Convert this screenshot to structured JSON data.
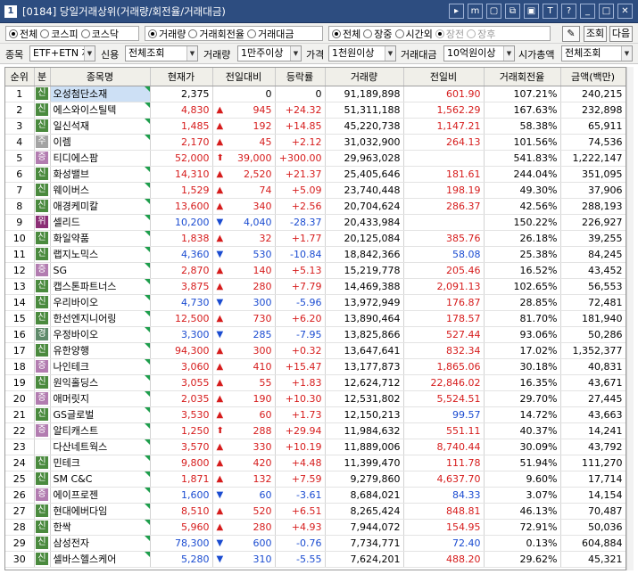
{
  "title": {
    "num": "1",
    "text": "[0184] 당일거래상위(거래량/회전율/거래대금)"
  },
  "titlebar_icons": [
    "▸",
    "m",
    "▢",
    "⧉",
    "▣",
    "T",
    "?",
    "_",
    "□",
    "✕"
  ],
  "icon_names": [
    "menu-arrow-icon",
    "memo-icon",
    "link-icon",
    "copy-icon",
    "window-icon",
    "font-icon",
    "help-icon",
    "minimize-icon",
    "maximize-icon",
    "close-icon"
  ],
  "market_group": [
    {
      "label": "전체",
      "checked": true
    },
    {
      "label": "코스피",
      "checked": false
    },
    {
      "label": "코스닥",
      "checked": false
    }
  ],
  "sort_group": [
    {
      "label": "거래량",
      "checked": true
    },
    {
      "label": "거래회전율",
      "checked": false
    },
    {
      "label": "거래대금",
      "checked": false
    }
  ],
  "session_group": [
    {
      "label": "전체",
      "checked": true,
      "disabled": false
    },
    {
      "label": "장중",
      "checked": false,
      "disabled": false
    },
    {
      "label": "시간외",
      "checked": false,
      "disabled": false
    },
    {
      "label": "장전",
      "checked": true,
      "disabled": true
    },
    {
      "label": "장후",
      "checked": false,
      "disabled": true
    }
  ],
  "buttons": {
    "query": "조회",
    "next": "다음"
  },
  "filters": {
    "item_label": "종목",
    "item_value": "ETF+ETN 제",
    "credit_label": "신용",
    "credit_value": "전체조회",
    "volume_label": "거래량",
    "volume_value": "1만주이상",
    "price_label": "가격",
    "price_value": "1천원이상",
    "amount_label": "거래대금",
    "amount_value": "10억원이상",
    "cap_label": "시가총액",
    "cap_value": "전체조회"
  },
  "columns": [
    "순위",
    "분",
    "종목명",
    "현재가",
    "전일대비",
    "등락률",
    "거래량",
    "전일비",
    "거래회전율",
    "금액(백만)"
  ],
  "rows": [
    {
      "rank": "1",
      "badge": "신",
      "name": "오성첨단소재",
      "price": "2,375",
      "dir": "",
      "change": "0",
      "rate": "0",
      "volume": "91,189,898",
      "prev": "601.90",
      "turnover": "107.21%",
      "amount": "240,215",
      "flag": true
    },
    {
      "rank": "2",
      "badge": "신",
      "name": "에스와이스틸텍",
      "price": "4,830",
      "dir": "up",
      "change": "945",
      "rate": "+24.32",
      "volume": "51,311,188",
      "prev": "1,562.29",
      "turnover": "167.63%",
      "amount": "232,898",
      "flag": true
    },
    {
      "rank": "3",
      "badge": "신",
      "name": "일신석재",
      "price": "1,485",
      "dir": "up",
      "change": "192",
      "rate": "+14.85",
      "volume": "45,220,738",
      "prev": "1,147.21",
      "turnover": "58.38%",
      "amount": "65,911",
      "flag": true
    },
    {
      "rank": "4",
      "badge": "주",
      "name": "이렘",
      "price": "2,170",
      "dir": "up",
      "change": "45",
      "rate": "+2.12",
      "volume": "31,032,900",
      "prev": "264.13",
      "turnover": "101.56%",
      "amount": "74,536",
      "flag": true
    },
    {
      "rank": "5",
      "badge": "증",
      "name": "티디에스팜",
      "price": "52,000",
      "dir": "upper",
      "change": "39,000",
      "rate": "+300.00",
      "volume": "29,963,028",
      "prev": "",
      "turnover": "541.83%",
      "amount": "1,222,147",
      "flag": false
    },
    {
      "rank": "6",
      "badge": "신",
      "name": "화성밸브",
      "price": "14,310",
      "dir": "up",
      "change": "2,520",
      "rate": "+21.37",
      "volume": "25,405,646",
      "prev": "181.61",
      "turnover": "244.04%",
      "amount": "351,095",
      "flag": true
    },
    {
      "rank": "7",
      "badge": "신",
      "name": "웨이버스",
      "price": "1,529",
      "dir": "up",
      "change": "74",
      "rate": "+5.09",
      "volume": "23,740,448",
      "prev": "198.19",
      "turnover": "49.30%",
      "amount": "37,906",
      "flag": true
    },
    {
      "rank": "8",
      "badge": "신",
      "name": "애경케미칼",
      "price": "13,600",
      "dir": "up",
      "change": "340",
      "rate": "+2.56",
      "volume": "20,704,624",
      "prev": "286.37",
      "turnover": "42.56%",
      "amount": "288,193",
      "flag": true
    },
    {
      "rank": "9",
      "badge": "위",
      "name": "셀리드",
      "price": "10,200",
      "dir": "dn",
      "change": "4,040",
      "rate": "-28.37",
      "volume": "20,433,984",
      "prev": "",
      "turnover": "150.22%",
      "amount": "226,927",
      "flag": true
    },
    {
      "rank": "10",
      "badge": "신",
      "name": "화일약품",
      "price": "1,838",
      "dir": "up",
      "change": "32",
      "rate": "+1.77",
      "volume": "20,125,084",
      "prev": "385.76",
      "turnover": "26.18%",
      "amount": "39,255",
      "flag": true
    },
    {
      "rank": "11",
      "badge": "신",
      "name": "랩지노믹스",
      "price": "4,360",
      "dir": "dn",
      "change": "530",
      "rate": "-10.84",
      "volume": "18,842,366",
      "prev": "58.08",
      "turnover": "25.38%",
      "amount": "84,245",
      "flag": true
    },
    {
      "rank": "12",
      "badge": "증",
      "name": "SG",
      "price": "2,870",
      "dir": "up",
      "change": "140",
      "rate": "+5.13",
      "volume": "15,219,778",
      "prev": "205.46",
      "turnover": "16.52%",
      "amount": "43,452",
      "flag": true
    },
    {
      "rank": "13",
      "badge": "신",
      "name": "캡스톤파트너스",
      "price": "3,875",
      "dir": "up",
      "change": "280",
      "rate": "+7.79",
      "volume": "14,469,388",
      "prev": "2,091.13",
      "turnover": "102.65%",
      "amount": "56,553",
      "flag": true
    },
    {
      "rank": "14",
      "badge": "신",
      "name": "우리바이오",
      "price": "4,730",
      "dir": "dn",
      "change": "300",
      "rate": "-5.96",
      "volume": "13,972,949",
      "prev": "176.87",
      "turnover": "28.85%",
      "amount": "72,481",
      "flag": true
    },
    {
      "rank": "15",
      "badge": "신",
      "name": "한선엔지니어링",
      "price": "12,500",
      "dir": "up",
      "change": "730",
      "rate": "+6.20",
      "volume": "13,890,464",
      "prev": "178.57",
      "turnover": "81.70%",
      "amount": "181,940",
      "flag": true
    },
    {
      "rank": "16",
      "badge": "경",
      "name": "우정바이오",
      "price": "3,300",
      "dir": "dn",
      "change": "285",
      "rate": "-7.95",
      "volume": "13,825,866",
      "prev": "527.44",
      "turnover": "93.06%",
      "amount": "50,286",
      "flag": true
    },
    {
      "rank": "17",
      "badge": "신",
      "name": "유한양행",
      "price": "94,300",
      "dir": "up",
      "change": "300",
      "rate": "+0.32",
      "volume": "13,647,641",
      "prev": "832.34",
      "turnover": "17.02%",
      "amount": "1,352,377",
      "flag": true
    },
    {
      "rank": "18",
      "badge": "증",
      "name": "나인테크",
      "price": "3,060",
      "dir": "up",
      "change": "410",
      "rate": "+15.47",
      "volume": "13,177,873",
      "prev": "1,865.06",
      "turnover": "30.18%",
      "amount": "40,831",
      "flag": true
    },
    {
      "rank": "19",
      "badge": "신",
      "name": "원익홀딩스",
      "price": "3,055",
      "dir": "up",
      "change": "55",
      "rate": "+1.83",
      "volume": "12,624,712",
      "prev": "22,846.02",
      "turnover": "16.35%",
      "amount": "43,671",
      "flag": true
    },
    {
      "rank": "20",
      "badge": "증",
      "name": "애머릿지",
      "price": "2,035",
      "dir": "up",
      "change": "190",
      "rate": "+10.30",
      "volume": "12,531,802",
      "prev": "5,524.51",
      "turnover": "29.70%",
      "amount": "27,445",
      "flag": true
    },
    {
      "rank": "21",
      "badge": "신",
      "name": "GS글로벌",
      "price": "3,530",
      "dir": "up",
      "change": "60",
      "rate": "+1.73",
      "volume": "12,150,213",
      "prev": "99.57",
      "turnover": "14.72%",
      "amount": "43,663",
      "flag": true
    },
    {
      "rank": "22",
      "badge": "증",
      "name": "알티캐스트",
      "price": "1,250",
      "dir": "upper",
      "change": "288",
      "rate": "+29.94",
      "volume": "11,984,632",
      "prev": "551.11",
      "turnover": "40.37%",
      "amount": "14,241",
      "flag": true
    },
    {
      "rank": "23",
      "badge": "",
      "name": "다산네트웍스",
      "price": "3,570",
      "dir": "up",
      "change": "330",
      "rate": "+10.19",
      "volume": "11,889,006",
      "prev": "8,740.44",
      "turnover": "30.09%",
      "amount": "43,792",
      "flag": true
    },
    {
      "rank": "24",
      "badge": "신",
      "name": "민테크",
      "price": "9,800",
      "dir": "up",
      "change": "420",
      "rate": "+4.48",
      "volume": "11,399,470",
      "prev": "111.78",
      "turnover": "51.94%",
      "amount": "111,270",
      "flag": true
    },
    {
      "rank": "25",
      "badge": "신",
      "name": "SM C&C",
      "price": "1,871",
      "dir": "up",
      "change": "132",
      "rate": "+7.59",
      "volume": "9,279,860",
      "prev": "4,637.70",
      "turnover": "9.60%",
      "amount": "17,714",
      "flag": true
    },
    {
      "rank": "26",
      "badge": "증",
      "name": "에이프로젠",
      "price": "1,600",
      "dir": "dn",
      "change": "60",
      "rate": "-3.61",
      "volume": "8,684,021",
      "prev": "84.33",
      "turnover": "3.07%",
      "amount": "14,154",
      "flag": true
    },
    {
      "rank": "27",
      "badge": "신",
      "name": "현대에버다임",
      "price": "8,510",
      "dir": "up",
      "change": "520",
      "rate": "+6.51",
      "volume": "8,265,424",
      "prev": "848.81",
      "turnover": "46.13%",
      "amount": "70,487",
      "flag": true
    },
    {
      "rank": "28",
      "badge": "신",
      "name": "한싹",
      "price": "5,960",
      "dir": "up",
      "change": "280",
      "rate": "+4.93",
      "volume": "7,944,072",
      "prev": "154.95",
      "turnover": "72.91%",
      "amount": "50,036",
      "flag": true
    },
    {
      "rank": "29",
      "badge": "신",
      "name": "삼성전자",
      "price": "78,300",
      "dir": "dn",
      "change": "600",
      "rate": "-0.76",
      "volume": "7,734,771",
      "prev": "72.40",
      "turnover": "0.13%",
      "amount": "604,884",
      "flag": true
    },
    {
      "rank": "30",
      "badge": "신",
      "name": "셀바스헬스케어",
      "price": "5,280",
      "dir": "dn",
      "change": "310",
      "rate": "-5.55",
      "volume": "7,624,201",
      "prev": "488.20",
      "turnover": "29.62%",
      "amount": "45,321",
      "flag": true
    }
  ]
}
